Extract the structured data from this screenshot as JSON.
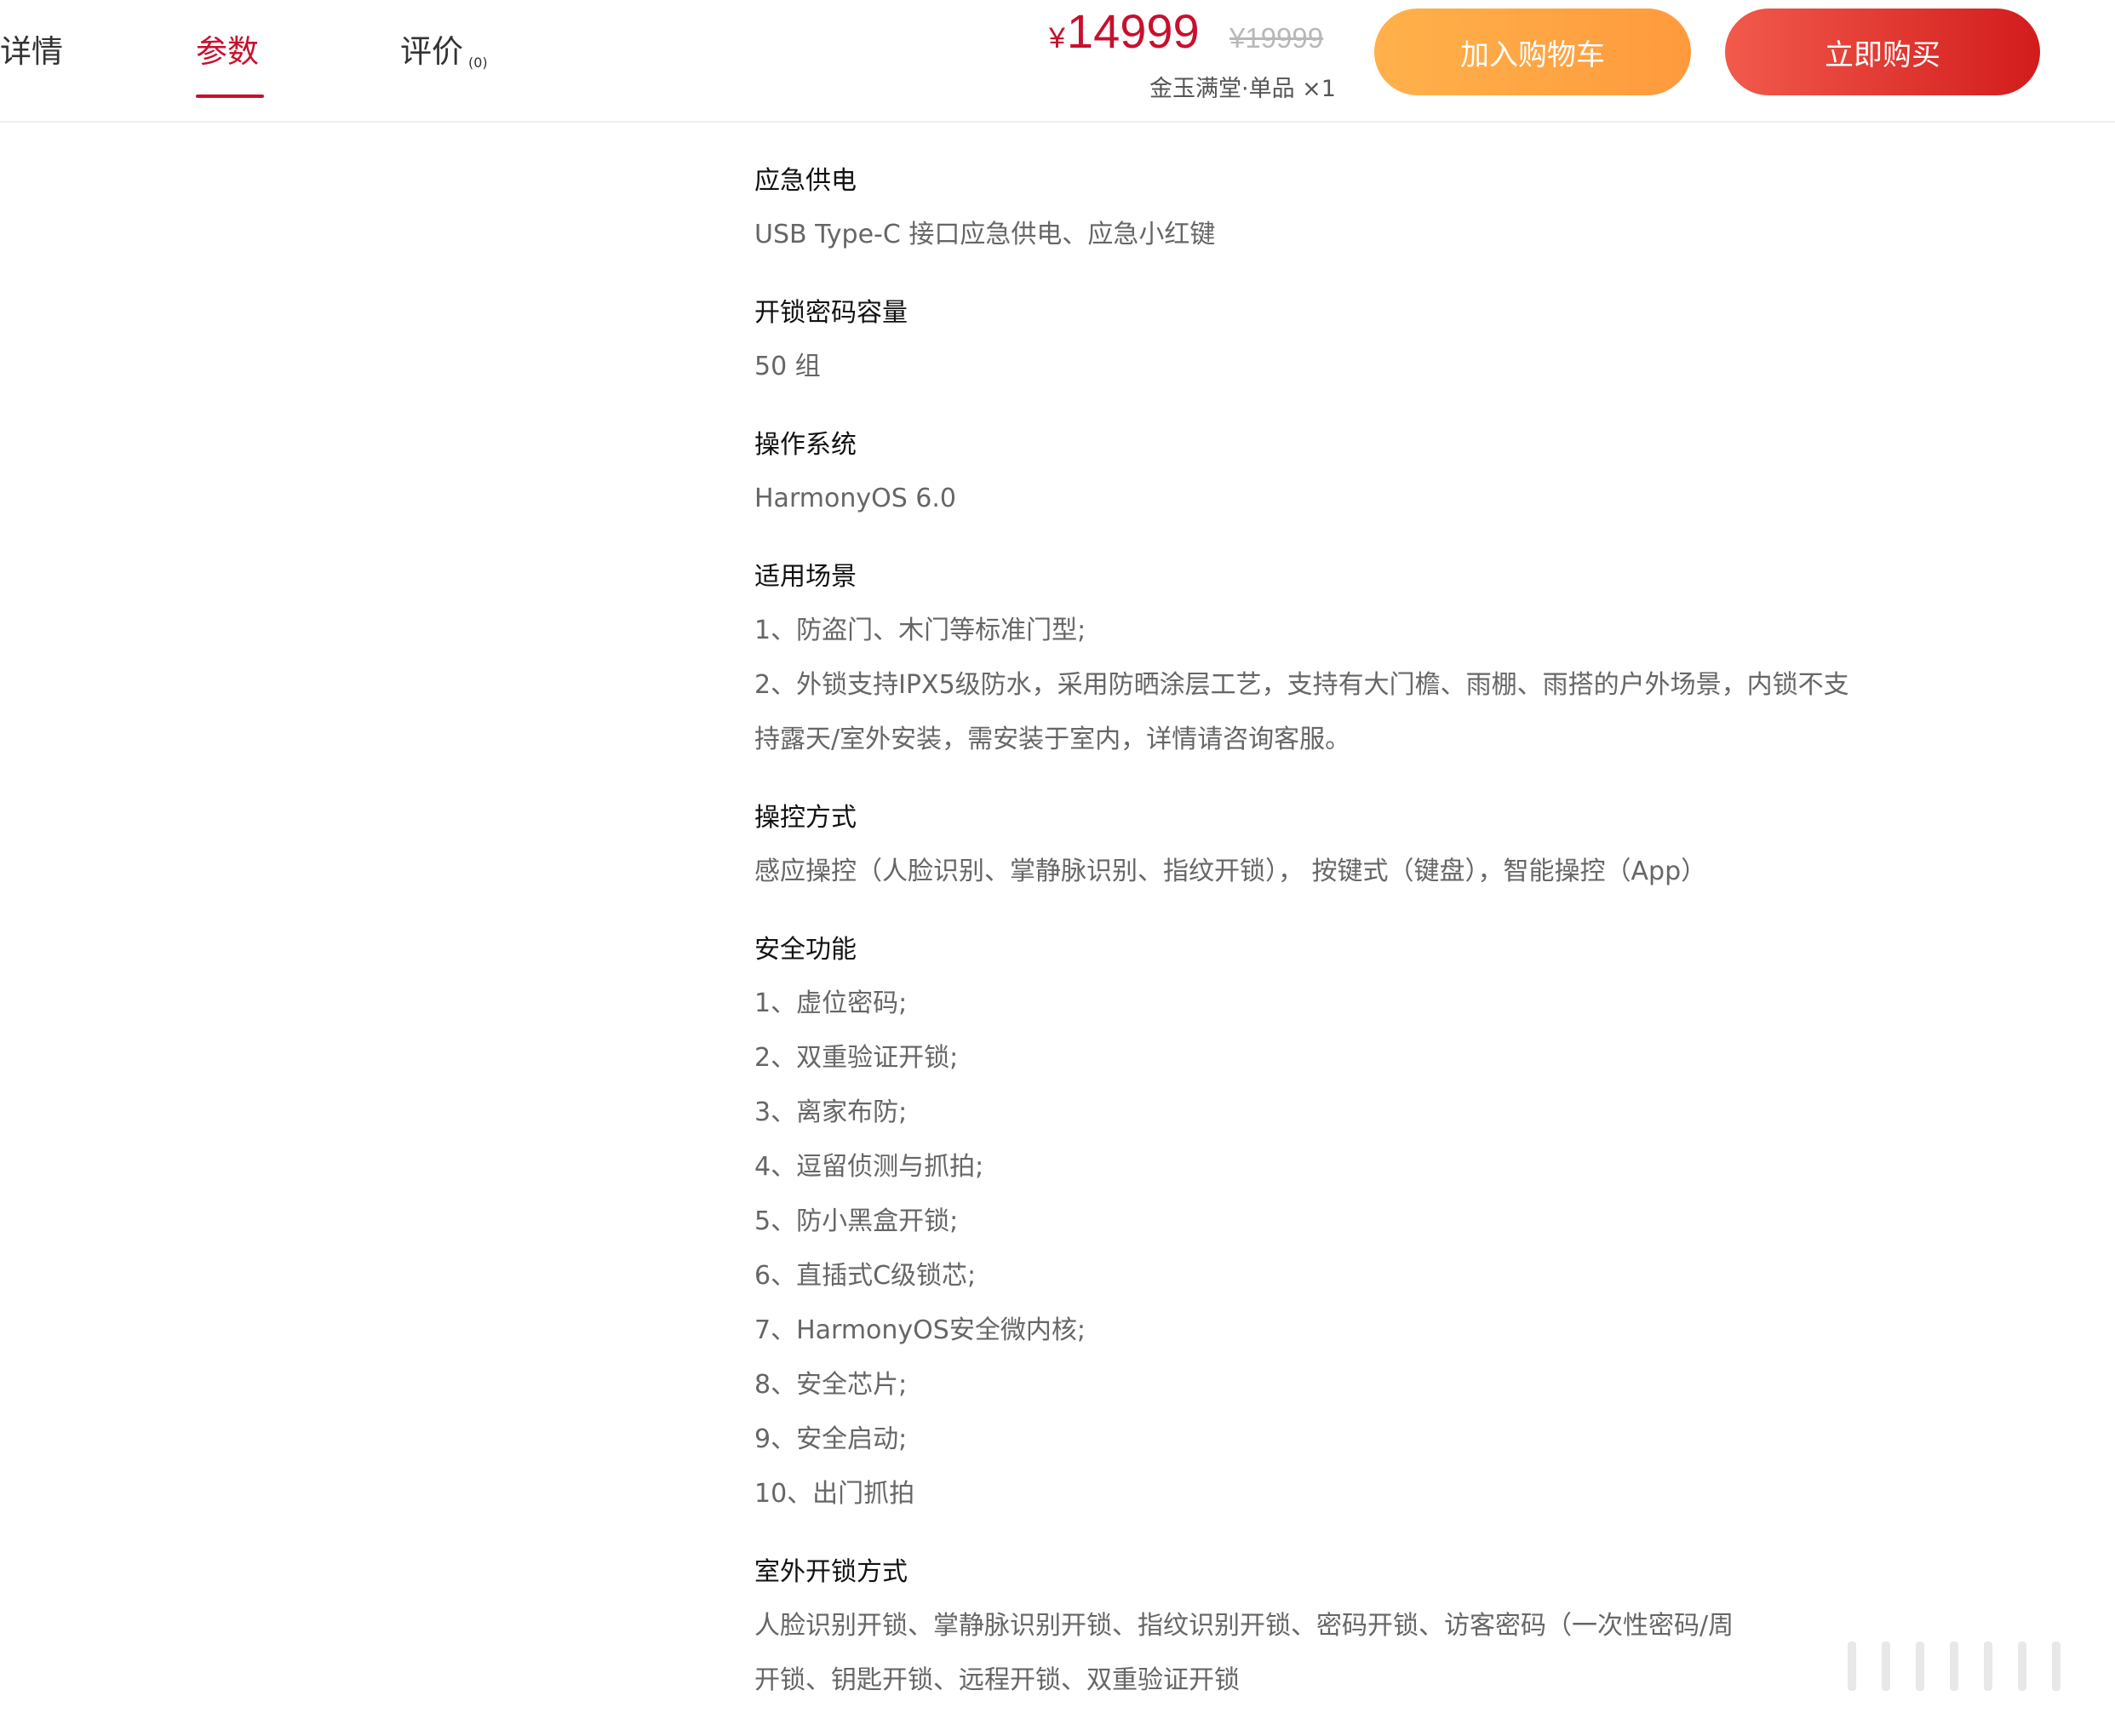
{
  "tabs": [
    {
      "label": "详情",
      "count": ""
    },
    {
      "label": "参数",
      "count": ""
    },
    {
      "label": "评价",
      "count": "(0)"
    }
  ],
  "price": {
    "currency": "¥",
    "current": "14999",
    "original": "¥19999",
    "variant": "金玉满堂·单品 ×1"
  },
  "buttons": {
    "cart": "加入购物车",
    "buy": "立即购买"
  },
  "colors": {
    "accent_red": "#c8102e",
    "cart_orange": "#ffa040",
    "buy_red": "#e53935"
  },
  "specs": [
    {
      "title": "应急供电",
      "lines": [
        "USB Type-C 接口应急供电、应急小红键"
      ]
    },
    {
      "title": "开锁密码容量",
      "lines": [
        "50 组"
      ]
    },
    {
      "title": "操作系统",
      "lines": [
        "HarmonyOS 6.0"
      ]
    },
    {
      "title": "适用场景",
      "lines": [
        "1、防盗门、木门等标准门型;",
        "2、外锁支持IPX5级防水，采用防晒涂层工艺，支持有大门檐、雨棚、雨搭的户外场景，内锁不支",
        "持露天/室外安装，需安装于室内，详情请咨询客服。"
      ]
    },
    {
      "title": "操控方式",
      "lines": [
        "感应操控（人脸识别、掌静脉识别、指纹开锁）， 按键式（键盘），智能操控（App）"
      ]
    },
    {
      "title": "安全功能",
      "lines": [
        "1、虚位密码;",
        "2、双重验证开锁;",
        "3、离家布防;",
        "4、逗留侦测与抓拍;",
        "5、防小黑盒开锁;",
        "6、直插式C级锁芯;",
        "7、HarmonyOS安全微内核;",
        "8、安全芯片;",
        "9、安全启动;",
        "10、出门抓拍"
      ]
    },
    {
      "title": "室外开锁方式",
      "lines": [
        "人脸识别开锁、掌静脉识别开锁、指纹识别开锁、密码开锁、访客密码（一次性密码/周",
        "开锁、钥匙开锁、远程开锁、双重验证开锁"
      ]
    }
  ]
}
